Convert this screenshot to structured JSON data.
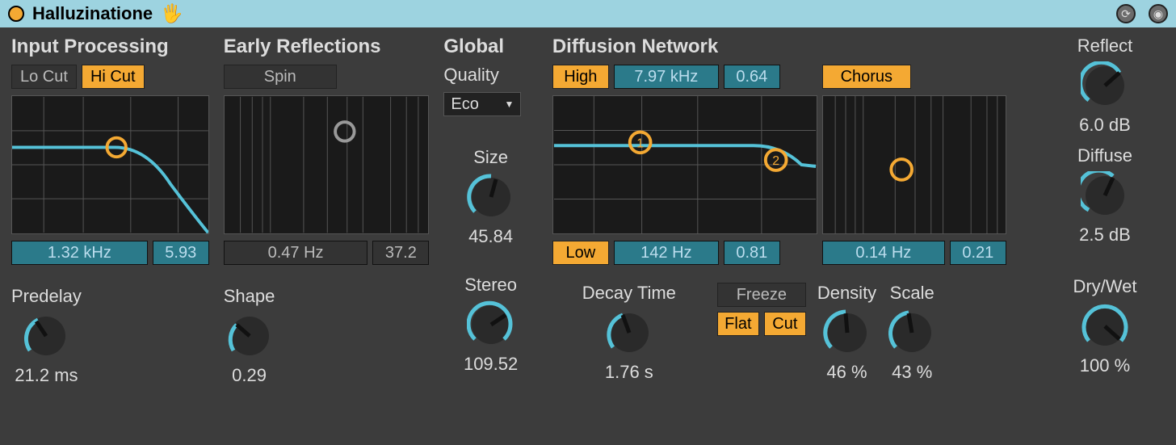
{
  "title": "Halluzinatione",
  "input_processing": {
    "heading": "Input Processing",
    "lo_cut": {
      "label": "Lo Cut",
      "on": false
    },
    "hi_cut": {
      "label": "Hi Cut",
      "on": true
    },
    "freq": "1.32 kHz",
    "amount": "5.93",
    "predelay": {
      "label": "Predelay",
      "value": "21.2 ms",
      "angle": -70
    }
  },
  "early_reflections": {
    "heading": "Early Reflections",
    "spin": {
      "label": "Spin",
      "on": false
    },
    "rate": "0.47 Hz",
    "amount": "37.2",
    "shape": {
      "label": "Shape",
      "value": "0.29",
      "angle": -80
    }
  },
  "global": {
    "heading": "Global",
    "quality_label": "Quality",
    "quality_value": "Eco",
    "size": {
      "label": "Size",
      "value": "45.84",
      "angle": -30
    },
    "stereo": {
      "label": "Stereo",
      "value": "109.52",
      "angle": 40
    }
  },
  "diffusion": {
    "heading": "Diffusion Network",
    "high_btn": "High",
    "high_freq": "7.97 kHz",
    "high_amount": "0.64",
    "chorus_btn": "Chorus",
    "low_btn": "Low",
    "low_freq": "142 Hz",
    "low_amount": "0.81",
    "chorus_rate": "0.14 Hz",
    "chorus_amount": "0.21",
    "decay": {
      "label": "Decay Time",
      "value": "1.76 s",
      "angle": -60
    },
    "freeze": {
      "label": "Freeze",
      "on": false
    },
    "flat": {
      "label": "Flat",
      "on": true
    },
    "cut": {
      "label": "Cut",
      "on": true
    },
    "density": {
      "label": "Density",
      "value": "46 %",
      "angle": -20
    },
    "scale": {
      "label": "Scale",
      "value": "43 %",
      "angle": -25
    }
  },
  "output": {
    "reflect": {
      "label": "Reflect",
      "value": "6.0 dB",
      "angle": 30
    },
    "diffuse": {
      "label": "Diffuse",
      "value": "2.5 dB",
      "angle": -20
    },
    "drywet": {
      "label": "Dry/Wet",
      "value": "100 %",
      "angle": 135
    }
  }
}
